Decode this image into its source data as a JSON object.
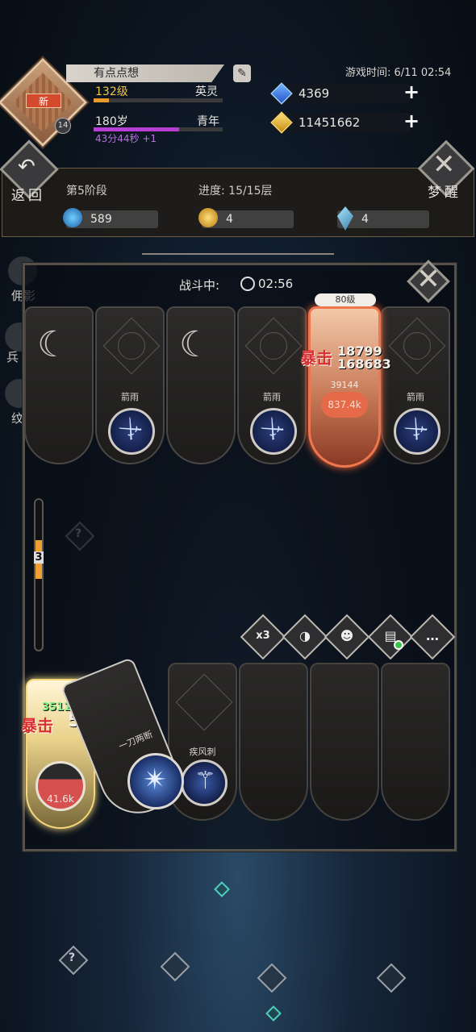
{
  "player": {
    "name": "有点点想",
    "avatar_badge": "新",
    "avatar_level": "14",
    "level": "132级",
    "rank": "英灵",
    "level_progress": 0.12,
    "age": "180岁",
    "life_stage": "青年",
    "age_progress": 0.66,
    "countdown": "43分44秒 +1"
  },
  "game_time": "游戏时间: 6/11 02:54",
  "resources": {
    "gems": "4369",
    "gold": "11451662"
  },
  "stage_panel": {
    "back_label": "返回",
    "wake_label": "梦醒",
    "stage": "第5阶段",
    "progress": "进度: 15/15层",
    "stats": [
      "589",
      "4",
      "4"
    ]
  },
  "side_menu": [
    "佣影",
    "兵",
    "纹"
  ],
  "battle": {
    "title": "战斗中:",
    "time": "02:56",
    "enemy_cards": [
      {
        "name": "",
        "type": "moon"
      },
      {
        "name": "箭雨",
        "type": "sword"
      },
      {
        "name": "",
        "type": "moon"
      },
      {
        "name": "箭雨",
        "type": "sword"
      },
      {
        "name": "箭雨",
        "type": "sword"
      }
    ],
    "boss": {
      "level": "80级",
      "hp_value": "39144",
      "hp_label": "837.4k",
      "crit_label": "暴击",
      "crit_damage_1": "18799",
      "crit_damage_2": "168683"
    },
    "round_counter": "3",
    "controls": [
      "x3",
      "",
      "",
      "",
      ""
    ],
    "player_cards": [
      {
        "name": "一刀两断"
      },
      {
        "name": "疾风刺"
      }
    ],
    "hero": {
      "hp_label": "41.6k",
      "dmg_top": "351171",
      "crit_label": "暴击",
      "crit_damage": "505"
    }
  },
  "colors": {
    "accent_gold": "#f2c54a",
    "age_bar": "#b73ed2",
    "crit_red": "#d83030",
    "boss_border": "#f0774d"
  }
}
